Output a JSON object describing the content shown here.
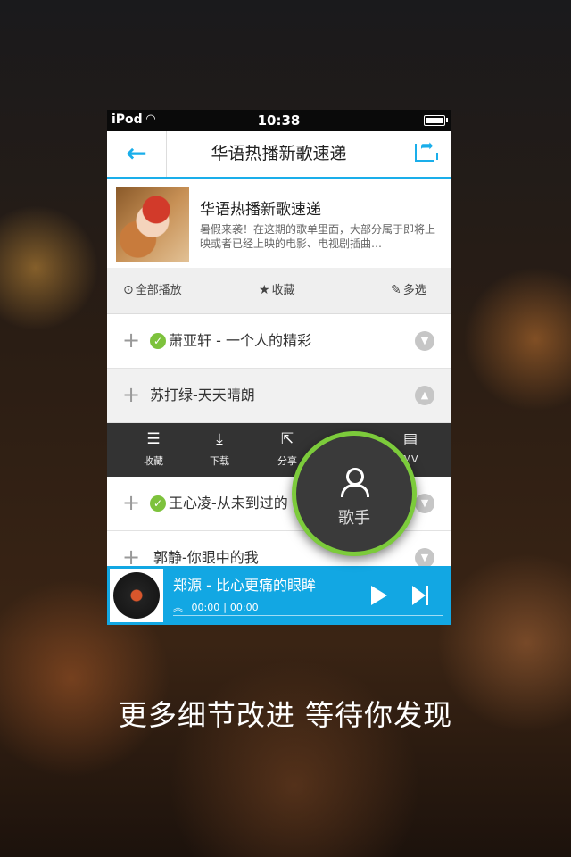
{
  "status": {
    "carrier": "iPod",
    "time": "10:38"
  },
  "nav": {
    "title": "华语热播新歌速递",
    "back_icon": "arrow-left-icon",
    "share_icon": "share-icon"
  },
  "album": {
    "title": "华语热播新歌速递",
    "description": "暑假来袭！在这期的歌单里面，大部分属于即将上映或者已经上映的电影、电视剧插曲…"
  },
  "actions": {
    "play_all": "全部播放",
    "favorite": "收藏",
    "multi_select": "多选"
  },
  "songs": [
    {
      "name": "萧亚轩 - 一个人的精彩",
      "downloaded": true
    },
    {
      "name": "苏打绿-天天晴朗",
      "downloaded": false
    },
    {
      "name": "王心凌-从未到过的",
      "downloaded": true
    },
    {
      "name": "郭静-你眼中的我",
      "downloaded": false
    }
  ],
  "toolbar": {
    "favorite": "收藏",
    "download": "下载",
    "share": "分享",
    "mv": "MV"
  },
  "fab": {
    "label": "歌手"
  },
  "player": {
    "title": "郑源 - 比心更痛的眼眸",
    "current_time": "00:00",
    "total_time": "00:00"
  },
  "caption": "更多细节改进 等待你发现",
  "colors": {
    "accent": "#1aaeea",
    "green": "#7dc23c"
  }
}
